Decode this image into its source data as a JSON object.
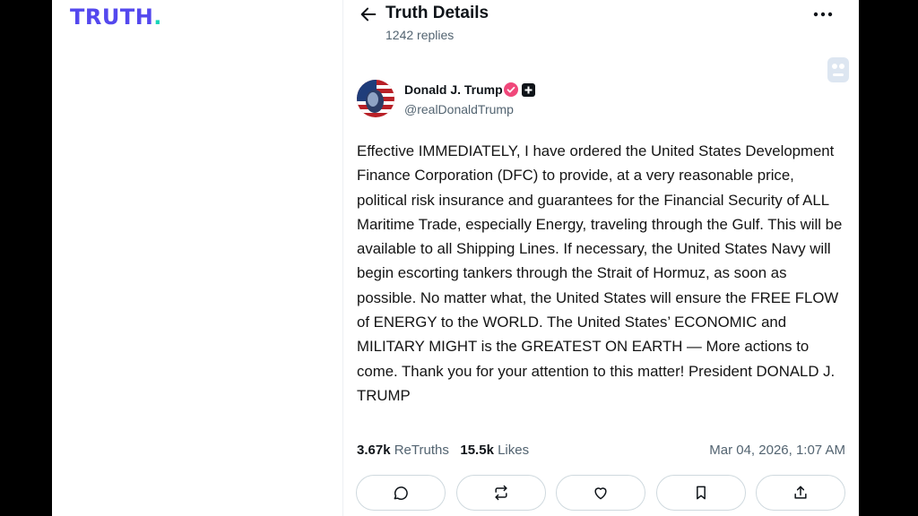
{
  "brand": {
    "logo_text": "TRUTH",
    "logo_dot": ".",
    "colors": {
      "logo": "#5448ee",
      "dot": "#17d4b8",
      "verified": "#f0477a"
    }
  },
  "header": {
    "title": "Truth Details",
    "replies": "1242 replies",
    "back_icon": "arrow-left-icon",
    "more_icon": "more-horizontal-icon"
  },
  "post": {
    "author_name": "Donald J. Trump",
    "author_handle": "@realDonaldTrump",
    "text": "Effective IMMEDIATELY, I have ordered the United States Development Finance Corporation (DFC) to provide, at a very reasonable price, political risk insurance and guarantees for the Financial Security of ALL Maritime Trade, especially Energy, traveling through the Gulf. This will be available to all Shipping Lines. If necessary, the United States Navy will begin escorting tankers through the Strait of Hormuz, as soon as possible. No matter what, the United States will ensure the FREE FLOW of ENERGY to the WORLD. The United States’ ECONOMIC and MILITARY MIGHT is the GREATEST ON EARTH — More actions to come. Thank you for your attention to this matter! President DONALD J. TRUMP",
    "retruths_count": "3.67k",
    "retruths_label": "ReTruths",
    "likes_count": "15.5k",
    "likes_label": "Likes",
    "timestamp": "Mar 04, 2026, 1:07 AM"
  },
  "actions": [
    "reply-icon",
    "retruth-icon",
    "like-icon",
    "bookmark-icon",
    "share-icon"
  ]
}
